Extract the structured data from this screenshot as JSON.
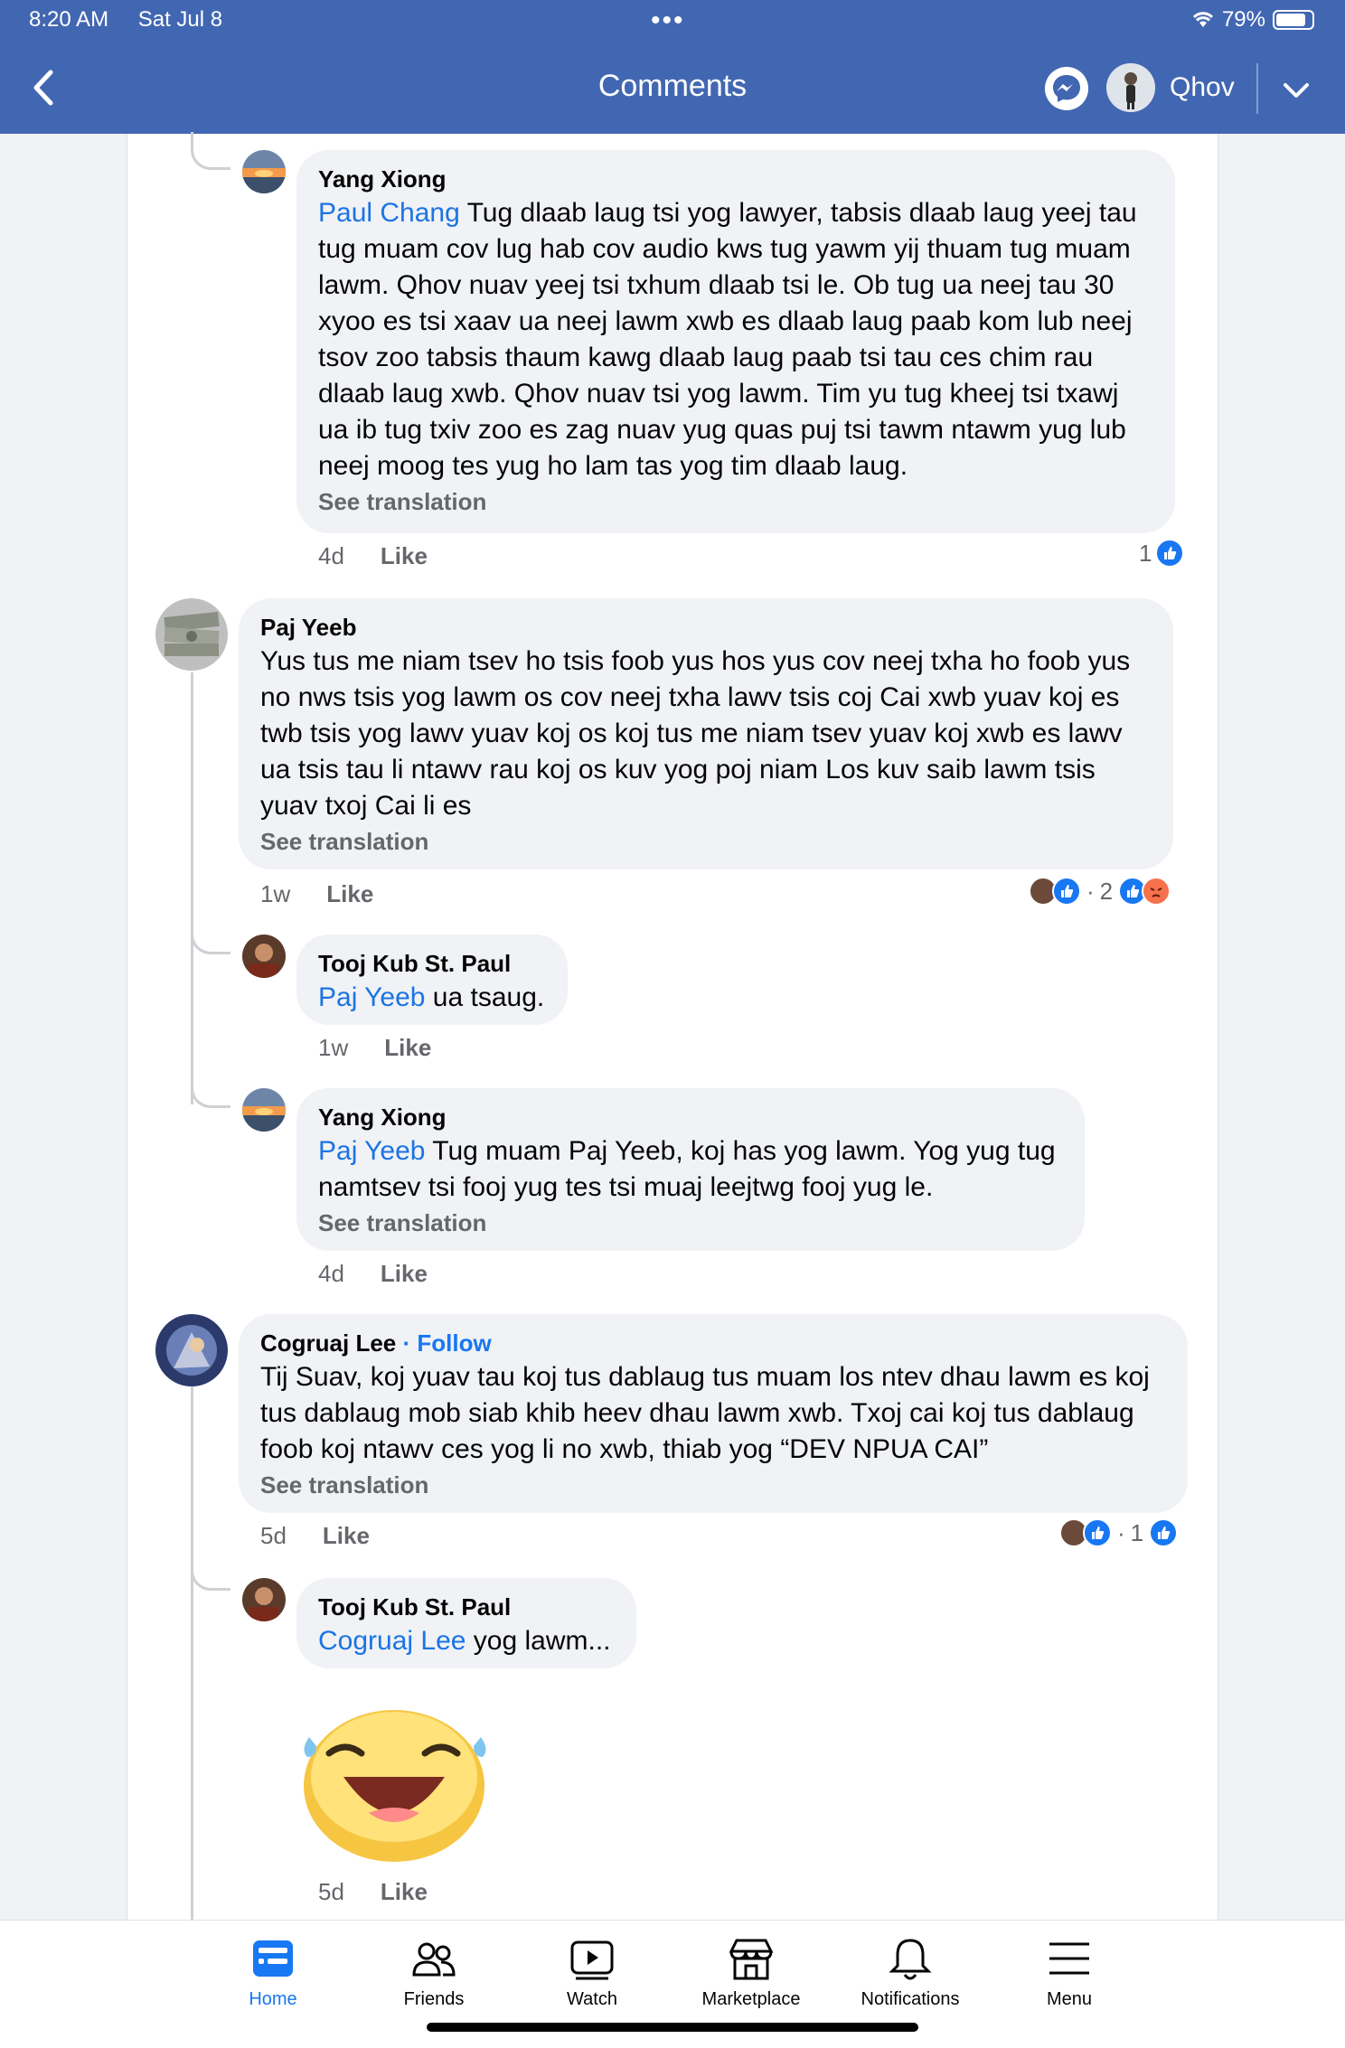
{
  "status_bar": {
    "time": "8:20 AM",
    "date": "Sat Jul 8",
    "battery": "79%"
  },
  "header": {
    "title": "Comments",
    "user_name": "Qhov"
  },
  "comments": [
    {
      "author": "Yang Xiong",
      "mention": "Paul Chang",
      "lines": [
        " Tug dlaab laug tsi yog lawyer, tabsis dlaab laug yeej tau",
        "tug muam cov lug hab cov audio kws tug yawm yij thuam tug muam",
        "lawm.  Qhov nuav yeej tsi txhum dlaab tsi le.  Ob tug ua neej tau 30",
        "xyoo es tsi xaav ua neej lawm xwb es dlaab laug paab kom lub neej",
        "tsov zoo tabsis thaum kawg dlaab laug paab tsi tau ces chim rau",
        "dlaab laug xwb.  Qhov nuav tsi yog lawm.  Tim yu tug kheej tsi txawj",
        "ua ib tug txiv zoo es zag nuav yug quas puj tsi tawm ntawm yug lub",
        "neej moog tes yug ho lam tas yog tim dlaab laug."
      ],
      "see_translation": "See translation",
      "time": "4d",
      "like": "Like",
      "reaction_count": "1"
    },
    {
      "author": "Paj Yeeb",
      "lines": [
        "Yus tus me niam tsev ho tsis foob yus hos yus cov neej txha ho foob yus",
        "no nws tsis yog lawm os cov neej txha lawv tsis coj Cai xwb yuav koj es",
        "twb tsis yog lawv yuav koj os koj tus me niam tsev yuav koj xwb es lawv",
        "ua tsis tau li ntawv rau koj os kuv yog poj niam Los kuv saib lawm tsis",
        "yuav txoj Cai li es"
      ],
      "see_translation": "See translation",
      "time": "1w",
      "like": "Like",
      "reaction_count": "2"
    },
    {
      "author": "Tooj Kub St. Paul",
      "mention": "Paj Yeeb",
      "text": " ua tsaug.",
      "time": "1w",
      "like": "Like"
    },
    {
      "author": "Yang Xiong",
      "mention": "Paj Yeeb",
      "lines": [
        " Tug muam Paj Yeeb, koj has yog lawm. Yog yug tug",
        "namtsev tsi fooj yug tes tsi muaj leejtwg fooj yug le."
      ],
      "see_translation": "See translation",
      "time": "4d",
      "like": "Like"
    },
    {
      "author": "Cogruaj Lee",
      "follow": "Follow",
      "lines": [
        "Tij Suav, koj yuav tau koj tus dablaug tus muam los ntev dhau lawm es koj",
        "tus dablaug mob siab khib heev dhau lawm xwb. Txoj cai koj tus dablaug",
        "foob koj ntawv ces yog li no xwb, thiab yog “DEV NPUA CAI”"
      ],
      "see_translation": "See translation",
      "time": "5d",
      "like": "Like",
      "reaction_count": "1"
    },
    {
      "author": "Tooj Kub St. Paul",
      "mention": "Cogruaj Lee",
      "text": " yog lawm...",
      "time": "5d",
      "like": "Like",
      "sticker": "laughing-emoji"
    }
  ],
  "tabs": [
    {
      "label": "Home",
      "icon": "home-icon"
    },
    {
      "label": "Friends",
      "icon": "friends-icon"
    },
    {
      "label": "Watch",
      "icon": "watch-icon"
    },
    {
      "label": "Marketplace",
      "icon": "marketplace-icon"
    },
    {
      "label": "Notifications",
      "icon": "bell-icon"
    },
    {
      "label": "Menu",
      "icon": "menu-icon"
    }
  ],
  "colors": {
    "header_bg": "#4267b2",
    "link": "#1b74e4",
    "bubble": "#f0f2f5",
    "muted": "#65676b",
    "like": "#1877f2"
  }
}
